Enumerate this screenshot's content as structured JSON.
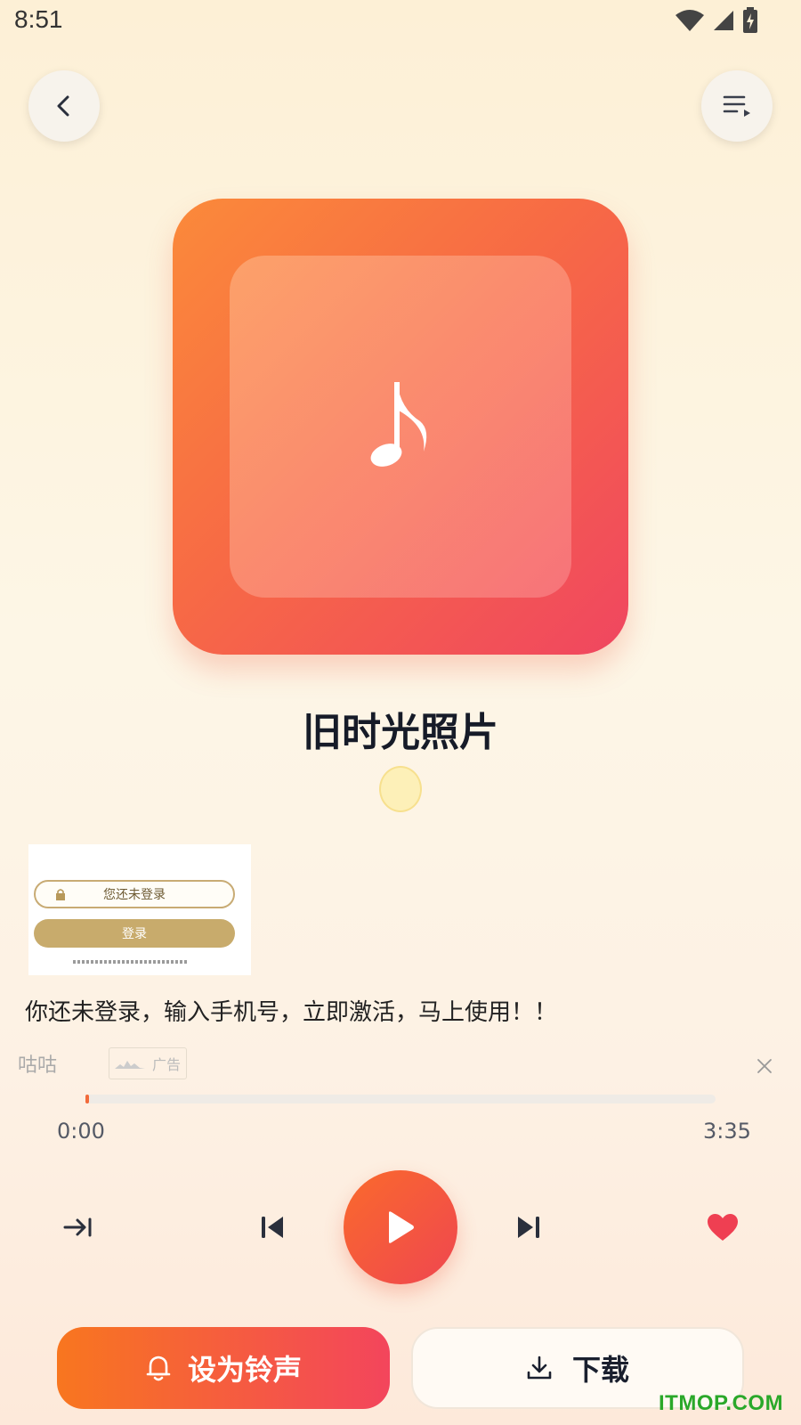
{
  "status_bar": {
    "time": "8:51"
  },
  "song": {
    "title": "旧时光照片"
  },
  "ad": {
    "thumb_status": "您还未登录",
    "thumb_button": "登录",
    "text": "你还未登录，输入手机号，立即激活，马上使用！！",
    "source": "咕咕",
    "badge": "广告"
  },
  "player": {
    "current_time": "0:00",
    "total_time": "3:35",
    "progress": 0.0,
    "liked": true
  },
  "actions": {
    "ringtone_label": "设为铃声",
    "download_label": "下载"
  },
  "watermark": "ITMOP.COM",
  "colors": {
    "accent": "#f76a3a",
    "accent_end": "#f04660",
    "like": "#ef3f52"
  }
}
